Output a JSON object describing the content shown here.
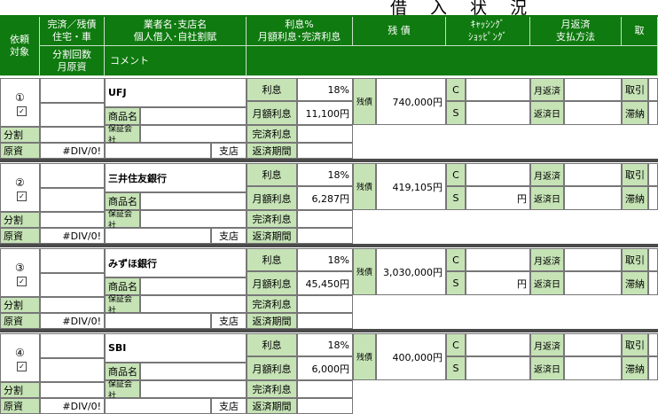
{
  "title": "借 入 状 況",
  "headers": {
    "col1_line1": "依頼",
    "col1_line2": "対象",
    "col2_line1": "完済／残債",
    "col2_line2": "住宅・車",
    "col2_line3": "分割回数",
    "col2_line4": "月原資",
    "col3_line1": "業者名･支店名",
    "col3_line2": "個人借入･自社割賦",
    "col3_line3": "コメント",
    "col4_line1": "利息%",
    "col4_line2": "月額利息･完済利息",
    "col5": "残 債",
    "col6_line1": "ｷｬｯｼﾝｸﾞ",
    "col6_line2": "ｼｮｯﾋﾟﾝｸﾞ",
    "col7_line1": "月返済",
    "col7_line2": "支払方法",
    "col8": "取"
  },
  "labels": {
    "bunkatsu": "分割",
    "genshi": "原資",
    "div_error": "#DIV/0!",
    "shiten": "支店",
    "shohinmei": "商品名",
    "hoshokaisha": "保証会社",
    "risoku": "利息",
    "getsugaku_risoku": "月額利息",
    "kansai_risoku": "完済利息",
    "hensai_kikan": "返済期間",
    "zansai": "残債",
    "c": "C",
    "s": "S",
    "tsukihensai": "月返済",
    "hensaibi": "返済日",
    "torihiki": "取引",
    "tainou": "滞納",
    "yen": "円",
    "check": "✓"
  },
  "rows": [
    {
      "num": "①",
      "lender": "UFJ",
      "rate": "18%",
      "monthly_interest": "11,100円",
      "balance": "740,000円",
      "s_value": ""
    },
    {
      "num": "②",
      "lender": "三井住友銀行",
      "rate": "18%",
      "monthly_interest": "6,287円",
      "balance": "419,105円",
      "s_value": "円"
    },
    {
      "num": "③",
      "lender": "みずほ銀行",
      "rate": "18%",
      "monthly_interest": "45,450円",
      "balance": "3,030,000円",
      "s_value": "円"
    },
    {
      "num": "④",
      "lender": "SBI",
      "rate": "18%",
      "monthly_interest": "6,000円",
      "balance": "400,000円",
      "s_value": ""
    }
  ],
  "colors": {
    "header_green": "#0f7a0f",
    "label_green": "#c6e3b6"
  }
}
